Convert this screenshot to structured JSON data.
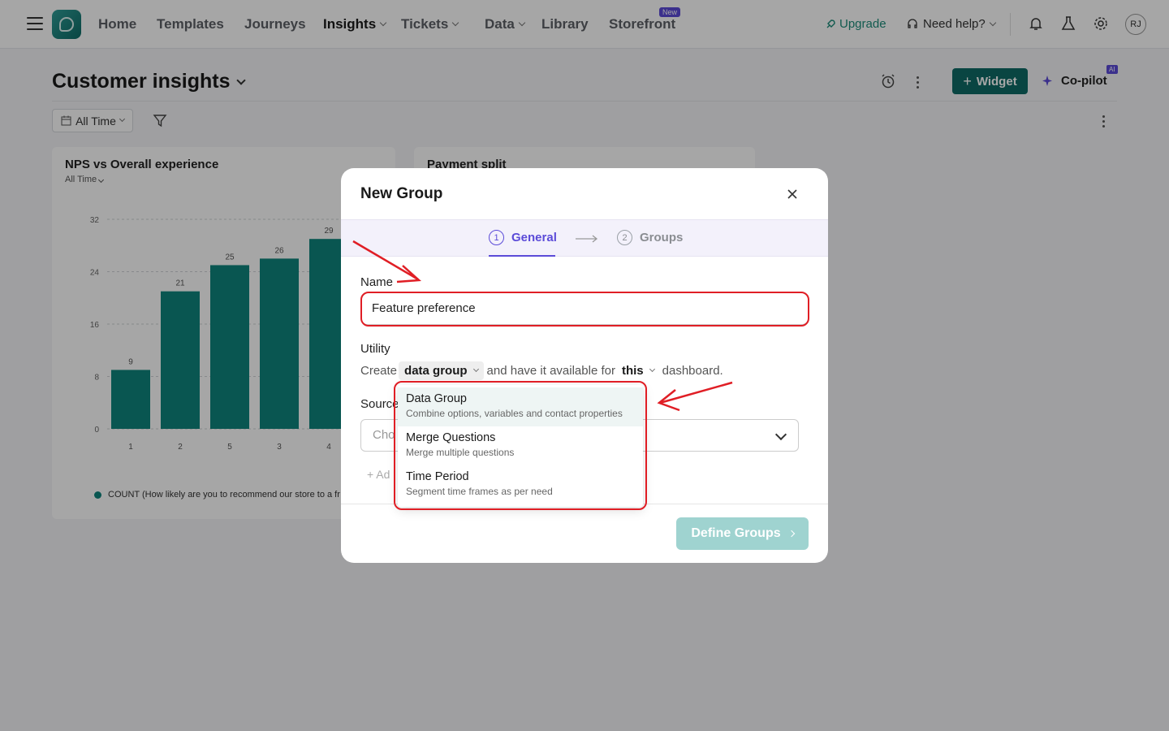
{
  "nav": {
    "items": [
      {
        "label": "Home"
      },
      {
        "label": "Templates"
      },
      {
        "label": "Journeys"
      },
      {
        "label": "Insights"
      },
      {
        "label": "Tickets"
      },
      {
        "label": "Data"
      },
      {
        "label": "Library"
      },
      {
        "label": "Storefront"
      }
    ],
    "new_badge": "New",
    "upgrade": "Upgrade",
    "help": "Need help?",
    "avatar": "RJ"
  },
  "page": {
    "title": "Customer insights",
    "widget_button": "Widget",
    "copilot": "Co-pilot",
    "ai_badge": "AI",
    "time_filter": "All Time"
  },
  "cards": {
    "nps": {
      "title": "NPS vs Overall experience",
      "subtitle": "All Time",
      "legend": "COUNT (How likely are you to recommend our store to a fr"
    },
    "payment": {
      "title": "Payment split"
    }
  },
  "chart_data": {
    "type": "bar",
    "title": "NPS vs Overall experience",
    "categories": [
      "1",
      "2",
      "5",
      "3",
      "4"
    ],
    "values": [
      9,
      21,
      25,
      26,
      29
    ],
    "ylim": [
      0,
      32
    ],
    "yticks": [
      0,
      8,
      16,
      24,
      32
    ],
    "series": [
      {
        "name": "COUNT (How likely are you to recommend our store to a fr",
        "values": [
          9,
          21,
          25,
          26,
          29
        ]
      }
    ],
    "color": "#0f857d",
    "legend": "bottom"
  },
  "modal": {
    "title": "New Group",
    "steps": [
      {
        "num": "1",
        "label": "General"
      },
      {
        "num": "2",
        "label": "Groups"
      }
    ],
    "name_label": "Name",
    "name_value": "Feature preference",
    "utility_label": "Utility",
    "utility": {
      "create": "Create",
      "type": "data group",
      "middle": "and have it available for",
      "scope": "this",
      "end": "dashboard."
    },
    "source_label": "Source",
    "source_placeholder": "Cho",
    "add_link": "+ Ad",
    "define_button": "Define Groups"
  },
  "dropdown": {
    "options": [
      {
        "title": "Data Group",
        "desc": "Combine options, variables and contact properties"
      },
      {
        "title": "Merge Questions",
        "desc": "Merge multiple questions"
      },
      {
        "title": "Time Period",
        "desc": "Segment time frames as per need"
      }
    ]
  }
}
